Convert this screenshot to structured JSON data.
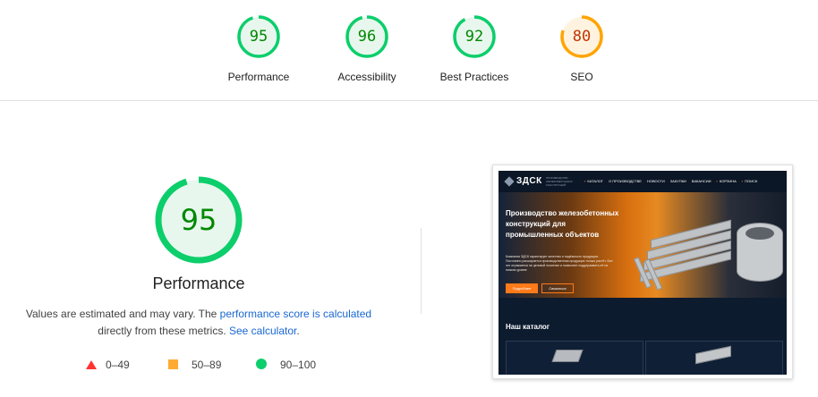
{
  "top_scores": [
    {
      "label": "Performance",
      "score": "95",
      "status": "pass"
    },
    {
      "label": "Accessibility",
      "score": "96",
      "status": "pass"
    },
    {
      "label": "Best Practices",
      "score": "92",
      "status": "pass"
    },
    {
      "label": "SEO",
      "score": "80",
      "status": "average"
    }
  ],
  "main_gauge": {
    "label": "Performance",
    "score": "95"
  },
  "description": {
    "text1": "Values are estimated and may vary. The ",
    "link1": "performance score is calculated",
    "text2": " directly from these metrics. ",
    "link2": "See calculator",
    "text3": "."
  },
  "legend": [
    {
      "icon": "red-triangle-icon",
      "range": "0–49"
    },
    {
      "icon": "orange-square-icon",
      "range": "50–89"
    },
    {
      "icon": "green-circle-icon",
      "range": "90–100"
    }
  ],
  "colors": {
    "pass": "#0cce6b",
    "pass_fill": "#e8f7ee",
    "average": "#ffa400",
    "average_fill": "#fff3e0",
    "fail": "#ff3333",
    "link": "#1967d2"
  },
  "screenshot": {
    "logo": "ЗДСК",
    "tagline": "ПРОИЗВОДСТВО ЖЕЛЕЗОБЕТОННЫХ КОНСТРУКЦИЙ",
    "nav": [
      "КАТАЛОГ",
      "О ПРОИЗВОДСТВЕ",
      "НОВОСТИ",
      "ЗАКУПКИ",
      "ВАКАНСИИ",
      "КОРЗИНА",
      "ПОИСК"
    ],
    "hero_title": "Производство железобетонных конструкций для промышленных объектов",
    "hero_text": "Компания ЗДСК гарантирует качество и надёжность продукции. Постоянно расширяется производственная продукция только растёт. Все это отражается на ценовой политике и позволяет поддерживать её на низком уровне",
    "btn_primary": "Подробнее",
    "btn_secondary": "Связаться",
    "catalog_title": "Наш каталог"
  }
}
